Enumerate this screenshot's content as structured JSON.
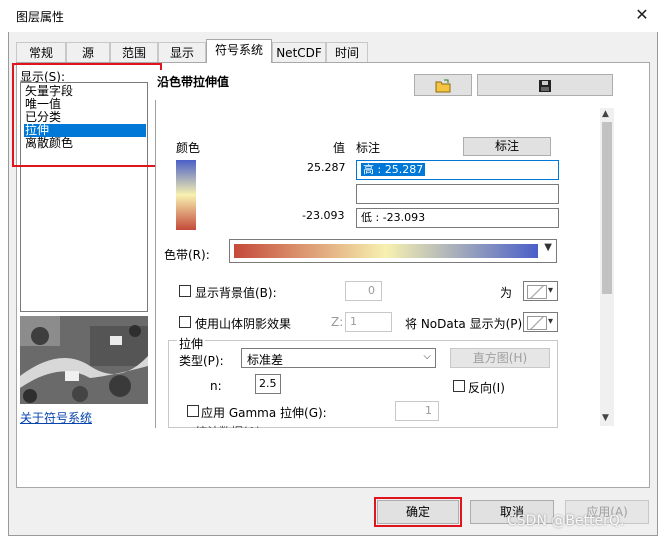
{
  "window": {
    "title": "图层属性",
    "close_glyph": "✕"
  },
  "tabs": [
    "常规",
    "源",
    "范围",
    "显示",
    "符号系统",
    "NetCDF",
    "时间"
  ],
  "left": {
    "show_label": "显示(S):",
    "items": [
      "矢量字段",
      "唯一值",
      "已分类",
      "拉伸",
      "离散颜色"
    ],
    "link": "关于符号系统"
  },
  "main": {
    "heading": "沿色带拉伸值",
    "col_color": "颜色",
    "col_value": "值",
    "col_label": "标注",
    "label_button": "标注",
    "high_value": "25.287",
    "low_value": "-23.093",
    "high_label": "高 : 25.287",
    "mid_label": "",
    "low_label": "低 : -23.093",
    "ramp_label": "色带(R):",
    "bg_label": "显示背景值(B):",
    "bg_value": "0",
    "as_label": "为",
    "hillshade_label": "使用山体阴影效果",
    "z_label": "Z:",
    "z_value": "1",
    "nodata_label": "将 NoData 显示为(P)",
    "stretch_group": "拉伸",
    "type_label": "类型(P):",
    "type_value": "标准差",
    "histogram_button": "直方图(H)",
    "n_label": "n:",
    "n_value": "2.5",
    "invert_label": "反向(I)",
    "gamma_label": "应用 Gamma 拉伸(G):",
    "gamma_value": "1",
    "cut_label": "统计数据(A)"
  },
  "footer": {
    "ok": "确定",
    "cancel": "取消",
    "apply": "应用(A)"
  },
  "watermark": "CSDN @BetterQ.",
  "colors": {
    "selection": "#0078d7",
    "highlight_box": "#e0141e",
    "ramp_high": "#4a5fc8",
    "ramp_mid": "#f7f1b0",
    "ramp_low": "#c44a3a"
  }
}
